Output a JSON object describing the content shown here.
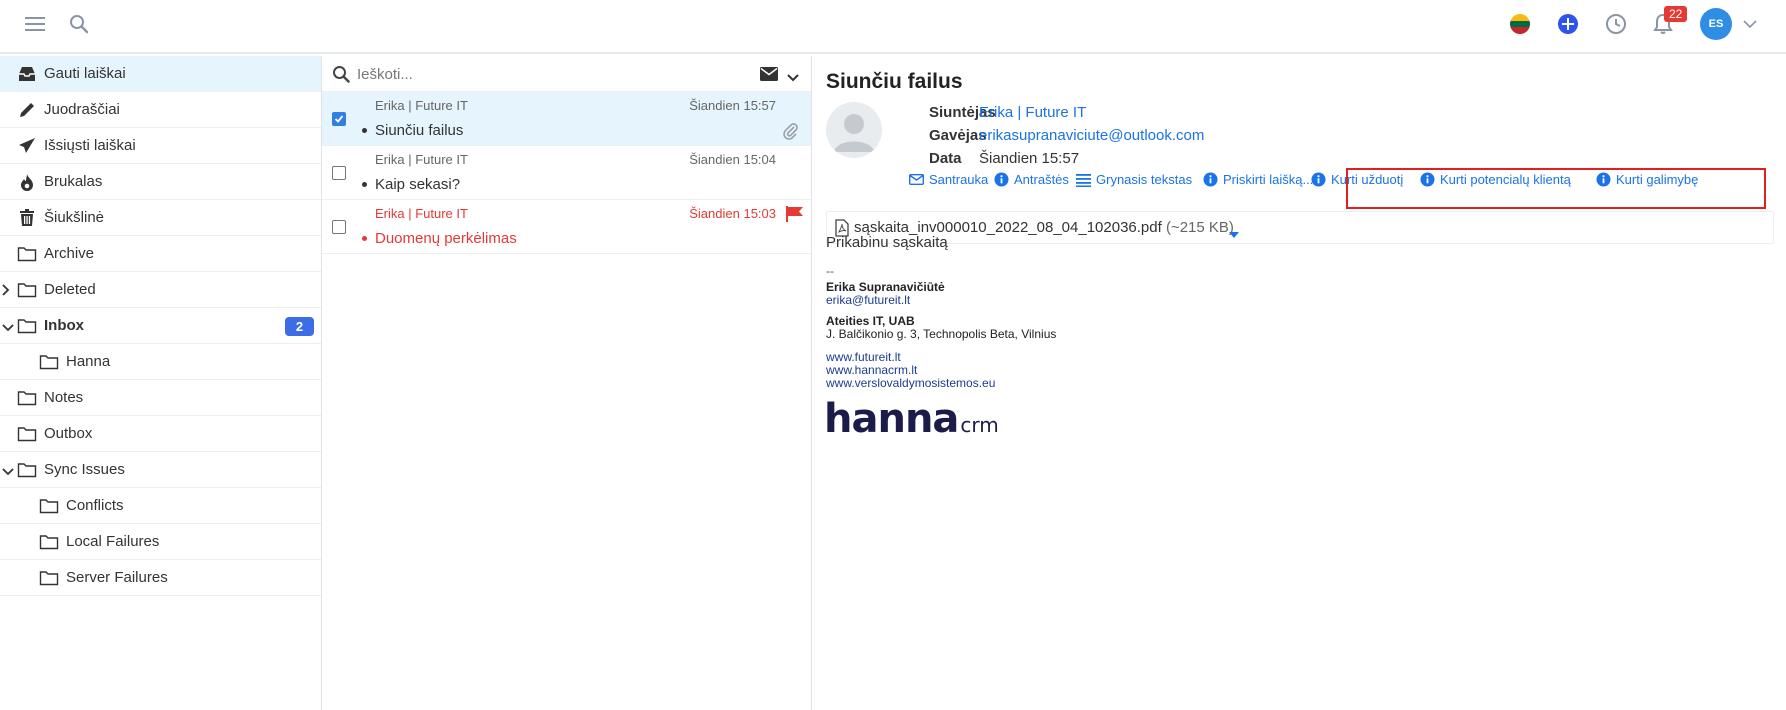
{
  "topbar": {
    "notification_count": "22",
    "user_initials": "ES"
  },
  "search": {
    "placeholder": "Ieškoti..."
  },
  "folders": [
    {
      "label": "Gauti laiškai",
      "icon": "inbox-tray-icon",
      "active": true
    },
    {
      "label": "Juodraščiai",
      "icon": "pencil-icon"
    },
    {
      "label": "Išsiųsti laiškai",
      "icon": "paper-plane-icon"
    },
    {
      "label": "Brukalas",
      "icon": "fire-icon"
    },
    {
      "label": "Šiukšlinė",
      "icon": "trash-icon"
    },
    {
      "label": "Archive",
      "icon": "folder-icon"
    },
    {
      "label": "Deleted",
      "icon": "folder-icon",
      "collapsed": true
    },
    {
      "label": "Inbox",
      "icon": "folder-icon",
      "expanded": true,
      "bold": true,
      "count": "2"
    },
    {
      "label": "Hanna",
      "icon": "folder-icon",
      "indent": true
    },
    {
      "label": "Notes",
      "icon": "folder-icon"
    },
    {
      "label": "Outbox",
      "icon": "folder-icon"
    },
    {
      "label": "Sync Issues",
      "icon": "folder-icon",
      "expanded": true
    },
    {
      "label": "Conflicts",
      "icon": "folder-icon",
      "indent": true
    },
    {
      "label": "Local Failures",
      "icon": "folder-icon",
      "indent": true
    },
    {
      "label": "Server Failures",
      "icon": "folder-icon",
      "indent": true
    }
  ],
  "messages": [
    {
      "from": "Erika | Future IT",
      "time": "Šiandien 15:57",
      "subject": "Siunčiu failus",
      "checked": true,
      "attachment": true
    },
    {
      "from": "Erika | Future IT",
      "time": "Šiandien 15:04",
      "subject": "Kaip sekasi?"
    },
    {
      "from": "Erika | Future IT",
      "time": "Šiandien 15:03",
      "subject": "Duomenų perkėlimas",
      "flagged": true,
      "color": "#e53935"
    }
  ],
  "reader": {
    "title": "Siunčiu failus",
    "sender_label": "Siuntėjas",
    "sender_value": "Erika | Future IT",
    "recipient_label": "Gavėjas",
    "recipient_value": "erikasupranaviciute@outlook.com",
    "date_label": "Data",
    "date_value": "Šiandien 15:57",
    "actions": {
      "summary": "Santrauka",
      "headers": "Antraštės",
      "plaintext": "Grynasis tekstas",
      "assign": "Priskirti laišką...",
      "create_task": "Kurti užduotį",
      "create_lead": "Kurti potencialų klientą",
      "create_opportunity": "Kurti galimybę"
    },
    "attachment": {
      "name": "sąskaita_inv000010_2022_08_04_102036.pdf",
      "size": "(~215 KB)"
    },
    "body": "Prikabinu sąskaitą",
    "signature": {
      "separator": "--",
      "name": "Erika Supranavičiūtė",
      "email": "erika@futureit.lt",
      "company": "Ateities IT, UAB",
      "address": "J. Balčikonio g. 3, Technopolis Beta, Vilnius",
      "site1": "www.futureit.lt",
      "site2": "www.hannacrm.lt",
      "site3": "www.verslovaldymosistemos.eu",
      "logo_main": "hanna",
      "logo_suffix": "crm"
    }
  },
  "colors": {
    "accent": "#1a73e8",
    "selected_row": "#e6f4fd",
    "badge_blue": "#3c6ce6",
    "alert_red": "#e53935",
    "highlight_box": "#e02020"
  }
}
